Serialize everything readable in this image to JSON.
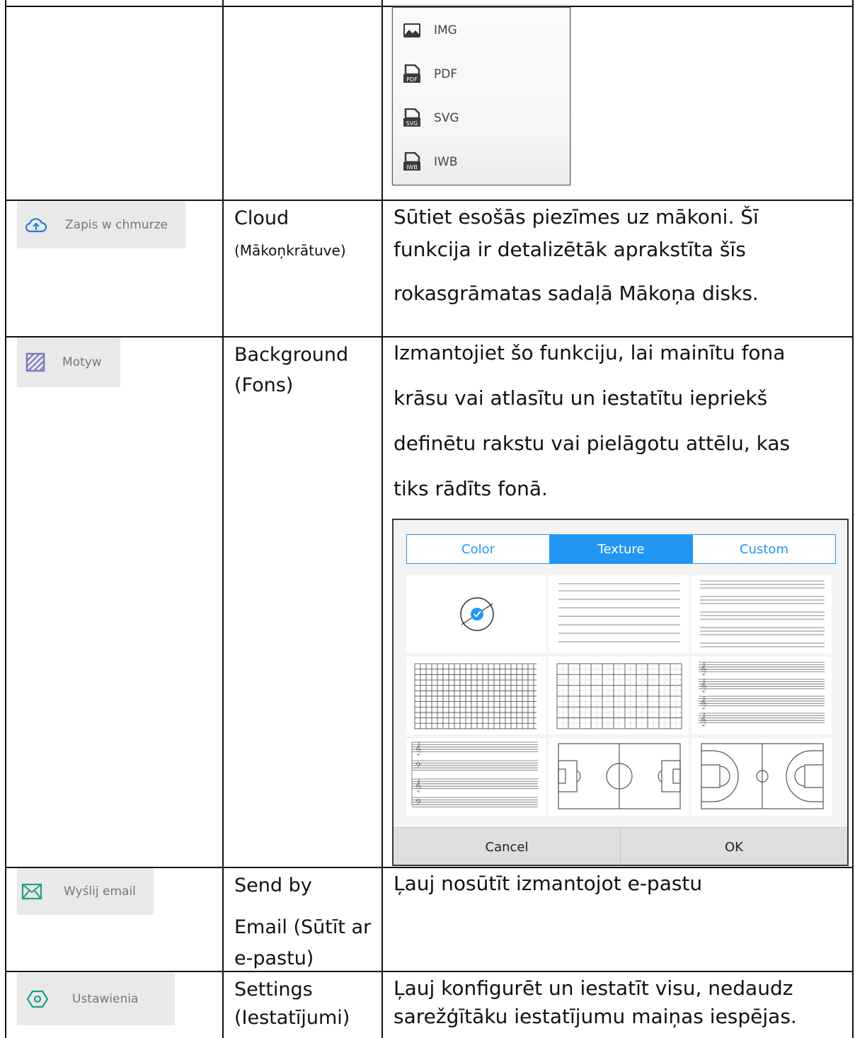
{
  "export_menu": {
    "items": [
      {
        "label": "IMG",
        "icon": "image-icon"
      },
      {
        "label": "PDF",
        "icon": "pdf-file-icon",
        "badge": "PDF"
      },
      {
        "label": "SVG",
        "icon": "svg-file-icon",
        "badge": "SVG"
      },
      {
        "label": "IWB",
        "icon": "iwb-file-icon",
        "badge": "IWB"
      }
    ]
  },
  "rows": [
    {
      "button_label": "Zapis w chmurze",
      "icon": "cloud-upload-icon",
      "name": "Cloud",
      "name_sub": "(Mākoņkrātuve)",
      "desc_lines": [
        "Sūtiet esošās piezīmes uz mākoni. Šī",
        "funkcija ir detalizētāk aprakstīta šīs",
        "rokasgrāmatas sadaļā Mākoņa disks."
      ]
    },
    {
      "button_label": "Motyw",
      "icon": "striped-square-icon",
      "name_lines": [
        "Background",
        "(Fons)"
      ],
      "desc_lines": [
        "Izmantojiet šo funkciju, lai mainītu fona",
        "krāsu vai atlasītu un iestatītu iepriekš",
        "definētu rakstu vai pielāgotu attēlu, kas",
        "tiks rādīts fonā."
      ]
    },
    {
      "button_label": "Wyślij email",
      "icon": "envelope-icon",
      "name_lines": [
        "Send by",
        "Email (Sūtīt ar",
        "e-pastu)"
      ],
      "desc_lines": [
        "Ļauj nosūtīt izmantojot e-pastu"
      ]
    },
    {
      "button_label": "Ustawienia",
      "icon": "settings-hexagon-icon",
      "name_lines": [
        "Settings",
        "(Iestatījumi)"
      ],
      "desc_lines": [
        "Ļauj konfigurēt un iestatīt visu, nedaudz",
        "sarežģītāku iestatījumu maiņas iespējas."
      ]
    }
  ],
  "background_dialog": {
    "tabs": [
      "Color",
      "Texture",
      "Custom"
    ],
    "active_tab": "Texture",
    "accent": "#2196f3",
    "cancel_label": "Cancel",
    "ok_label": "OK",
    "textures": [
      "blank-selected",
      "ruled-wide",
      "ruled-narrow",
      "grid-fine",
      "grid-dotted",
      "music-staff-treble",
      "music-staff-grand",
      "soccer-field",
      "basketball-court"
    ]
  }
}
